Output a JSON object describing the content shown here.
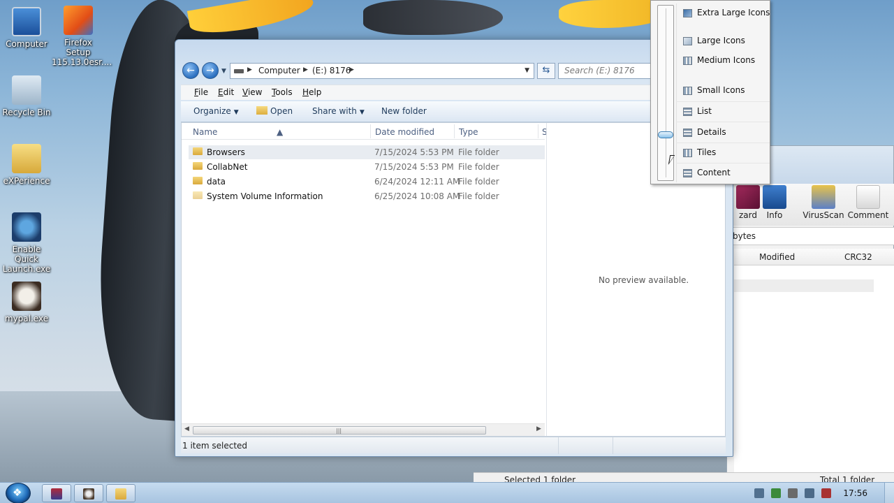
{
  "desktop": {
    "icons": [
      {
        "label": "Computer",
        "icon": "computer-icon"
      },
      {
        "label": "Firefox Setup 115.13.0esr....",
        "icon": "installer-icon"
      },
      {
        "label": "Recycle Bin",
        "icon": "recycle-bin-icon"
      },
      {
        "label": "eXPerience",
        "icon": "folder-icon"
      },
      {
        "label": "Enable Quick Launch.exe",
        "icon": "quick-launch-icon"
      },
      {
        "label": "mypal.exe",
        "icon": "mypal-icon"
      }
    ]
  },
  "explorer": {
    "breadcrumb": {
      "root": "Computer",
      "drive": "(E:) 8176"
    },
    "search_placeholder": "Search (E:) 8176",
    "menu": [
      "File",
      "Edit",
      "View",
      "Tools",
      "Help"
    ],
    "commands": {
      "organize": "Organize",
      "open": "Open",
      "share_with": "Share with",
      "new_folder": "New folder"
    },
    "columns": {
      "name": "Name",
      "date_modified": "Date modified",
      "type": "Type",
      "size": "S"
    },
    "files": [
      {
        "name": "Browsers",
        "date": "7/15/2024 5:53 PM",
        "type": "File folder",
        "selected": true
      },
      {
        "name": "CollabNet",
        "date": "7/15/2024 5:53 PM",
        "type": "File folder",
        "selected": false
      },
      {
        "name": "data",
        "date": "6/24/2024 12:11 AM",
        "type": "File folder",
        "selected": false
      },
      {
        "name": "System Volume Information",
        "date": "6/25/2024 10:08 AM",
        "type": "File folder",
        "selected": false
      }
    ],
    "preview_text": "No preview available.",
    "status": "1 item selected"
  },
  "view_menu": {
    "items": [
      "Extra Large Icons",
      "Large Icons",
      "Medium Icons",
      "Small Icons",
      "List",
      "Details",
      "Tiles",
      "Content"
    ],
    "current": "Details"
  },
  "background_app": {
    "toolbar": [
      {
        "label": "zard",
        "icon": "wizard-icon"
      },
      {
        "label": "Info",
        "icon": "info-icon"
      },
      {
        "label": "VirusScan",
        "icon": "virusscan-icon"
      },
      {
        "label": "Comment",
        "icon": "comment-icon"
      }
    ],
    "address_fragment": "bytes",
    "columns": {
      "modified": "Modified",
      "crc32": "CRC32"
    },
    "status_left": "Selected 1 folder",
    "status_right": "Total 1 folder"
  },
  "taskbar": {
    "start_label": "Start",
    "clock": "17:56"
  }
}
